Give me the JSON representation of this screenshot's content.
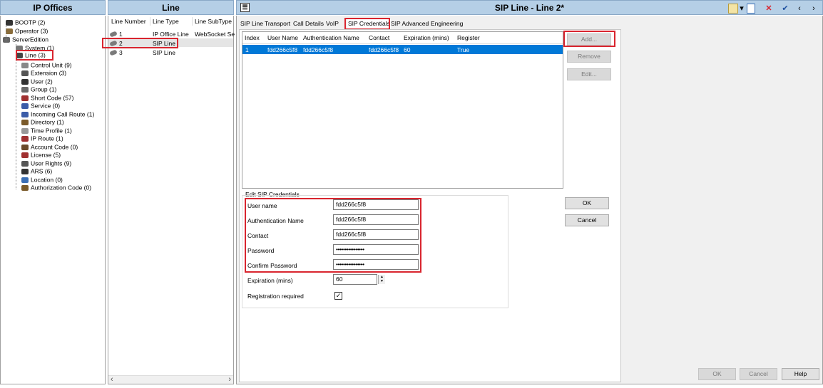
{
  "ip_offices": {
    "header": "IP Offices",
    "tree": [
      {
        "label": "BOOTP (2)",
        "icon": "bootp-icon"
      },
      {
        "label": "Operator (3)",
        "icon": "operator-icon"
      },
      {
        "label": "ServerEdition",
        "icon": "server-edition-icon"
      },
      {
        "label": "System (1)",
        "icon": "system-icon"
      },
      {
        "label": "Line (3)",
        "icon": "line-icon"
      },
      {
        "label": "Control Unit (9)",
        "icon": "control-unit-icon"
      },
      {
        "label": "Extension (3)",
        "icon": "extension-icon"
      },
      {
        "label": "User (2)",
        "icon": "user-icon"
      },
      {
        "label": "Group (1)",
        "icon": "group-icon"
      },
      {
        "label": "Short Code (57)",
        "icon": "short-code-icon"
      },
      {
        "label": "Service (0)",
        "icon": "service-icon"
      },
      {
        "label": "Incoming Call Route (1)",
        "icon": "incoming-call-route-icon"
      },
      {
        "label": "Directory (1)",
        "icon": "directory-icon"
      },
      {
        "label": "Time Profile (1)",
        "icon": "time-profile-icon"
      },
      {
        "label": "IP Route (1)",
        "icon": "ip-route-icon"
      },
      {
        "label": "Account Code (0)",
        "icon": "account-code-icon"
      },
      {
        "label": "License (5)",
        "icon": "license-icon"
      },
      {
        "label": "User Rights (9)",
        "icon": "user-rights-icon"
      },
      {
        "label": "ARS (6)",
        "icon": "ars-icon"
      },
      {
        "label": "Location (0)",
        "icon": "location-icon"
      },
      {
        "label": "Authorization Code (0)",
        "icon": "authorization-code-icon"
      }
    ]
  },
  "line_list": {
    "header": "Line",
    "columns": [
      "Line Number",
      "Line Type",
      "Line SubType"
    ],
    "rows": [
      {
        "number": "1",
        "type": "IP Office Line",
        "subtype": "WebSocket Se"
      },
      {
        "number": "2",
        "type": "SIP Line",
        "subtype": ""
      },
      {
        "number": "3",
        "type": "SIP Line",
        "subtype": ""
      }
    ],
    "scroll_left": "‹",
    "scroll_right": "›"
  },
  "editor": {
    "title": "SIP Line - Line 2*",
    "tabs": [
      "SIP Line",
      "Transport",
      "Call Details",
      "VoIP",
      "SIP Credentials",
      "SIP Advanced",
      "Engineering"
    ],
    "grid": {
      "columns": [
        "Index",
        "User Name",
        "Authentication Name",
        "Contact",
        "Expiration (mins)",
        "Register"
      ],
      "rows": [
        {
          "index": "1",
          "user_name": "fdd266c5f8",
          "auth_name": "fdd266c5f8",
          "contact": "fdd266c5f8",
          "expiration": "60",
          "register": "True"
        }
      ]
    },
    "side_buttons": {
      "add": "Add...",
      "remove": "Remove",
      "edit": "Edit..."
    },
    "edit_section": {
      "title": "Edit SIP Credentials",
      "user_name_label": "User name",
      "user_name_value": "fdd266c5f8",
      "auth_name_label": "Authentication Name",
      "auth_name_value": "fdd266c5f8",
      "contact_label": "Contact",
      "contact_value": "fdd266c5f8",
      "password_label": "Password",
      "password_value": "••••••••••••••••",
      "confirm_password_label": "Confirm Password",
      "confirm_password_value": "••••••••••••••••",
      "expiration_label": "Expiration (mins)",
      "expiration_value": "60",
      "registration_label": "Registration required",
      "registration_checked": true
    },
    "dialog_buttons": {
      "ok": "OK",
      "cancel": "Cancel"
    },
    "footer_buttons": {
      "ok": "OK",
      "cancel": "Cancel",
      "help": "Help"
    },
    "toolbar": {
      "new": "▾",
      "close": "✕",
      "apply": "✔",
      "prev": "‹",
      "next": "›"
    },
    "colors": {
      "header_bg": "#b5cfe6",
      "highlight": "#0078d7",
      "callout_red": "#d9252f"
    }
  }
}
